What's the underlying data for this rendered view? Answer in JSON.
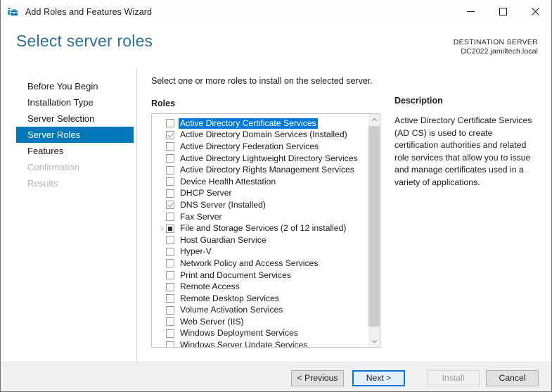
{
  "window": {
    "title": "Add Roles and Features Wizard",
    "app_icon": "wizard-toolbox-icon",
    "controls": {
      "minimize": "minimize-icon",
      "maximize": "maximize-icon",
      "close": "close-icon"
    }
  },
  "header": {
    "page_title": "Select server roles",
    "destination_label": "DESTINATION SERVER",
    "destination_value": "DC2022.jamiltech.local"
  },
  "nav": {
    "items": [
      {
        "label": "Before You Begin",
        "state": "normal"
      },
      {
        "label": "Installation Type",
        "state": "normal"
      },
      {
        "label": "Server Selection",
        "state": "normal"
      },
      {
        "label": "Server Roles",
        "state": "selected"
      },
      {
        "label": "Features",
        "state": "normal"
      },
      {
        "label": "Confirmation",
        "state": "disabled"
      },
      {
        "label": "Results",
        "state": "disabled"
      }
    ]
  },
  "main": {
    "instruction": "Select one or more roles to install on the selected server.",
    "roles_label": "Roles",
    "roles": [
      {
        "label": "Active Directory Certificate Services",
        "checked": "unchecked",
        "selected": true,
        "expandable": false
      },
      {
        "label": "Active Directory Domain Services (Installed)",
        "checked": "checked",
        "selected": false,
        "expandable": false
      },
      {
        "label": "Active Directory Federation Services",
        "checked": "unchecked",
        "selected": false,
        "expandable": false
      },
      {
        "label": "Active Directory Lightweight Directory Services",
        "checked": "unchecked",
        "selected": false,
        "expandable": false
      },
      {
        "label": "Active Directory Rights Management Services",
        "checked": "unchecked",
        "selected": false,
        "expandable": false
      },
      {
        "label": "Device Health Attestation",
        "checked": "unchecked",
        "selected": false,
        "expandable": false
      },
      {
        "label": "DHCP Server",
        "checked": "unchecked",
        "selected": false,
        "expandable": false
      },
      {
        "label": "DNS Server (Installed)",
        "checked": "checked",
        "selected": false,
        "expandable": false
      },
      {
        "label": "Fax Server",
        "checked": "unchecked",
        "selected": false,
        "expandable": false
      },
      {
        "label": "File and Storage Services (2 of 12 installed)",
        "checked": "partial",
        "selected": false,
        "expandable": true
      },
      {
        "label": "Host Guardian Service",
        "checked": "unchecked",
        "selected": false,
        "expandable": false
      },
      {
        "label": "Hyper-V",
        "checked": "unchecked",
        "selected": false,
        "expandable": false
      },
      {
        "label": "Network Policy and Access Services",
        "checked": "unchecked",
        "selected": false,
        "expandable": false
      },
      {
        "label": "Print and Document Services",
        "checked": "unchecked",
        "selected": false,
        "expandable": false
      },
      {
        "label": "Remote Access",
        "checked": "unchecked",
        "selected": false,
        "expandable": false
      },
      {
        "label": "Remote Desktop Services",
        "checked": "unchecked",
        "selected": false,
        "expandable": false
      },
      {
        "label": "Volume Activation Services",
        "checked": "unchecked",
        "selected": false,
        "expandable": false
      },
      {
        "label": "Web Server (IIS)",
        "checked": "unchecked",
        "selected": false,
        "expandable": false
      },
      {
        "label": "Windows Deployment Services",
        "checked": "unchecked",
        "selected": false,
        "expandable": false
      },
      {
        "label": "Windows Server Update Services",
        "checked": "unchecked",
        "selected": false,
        "expandable": false
      }
    ],
    "scrollbar": {
      "up_icon": "chevron-up-icon",
      "down_icon": "chevron-down-icon"
    },
    "description": {
      "title": "Description",
      "text": "Active Directory Certificate Services (AD CS) is used to create certification authorities and related role services that allow you to issue and manage certificates used in a variety of applications."
    }
  },
  "footer": {
    "previous": "< Previous",
    "next": "Next >",
    "install": "Install",
    "cancel": "Cancel"
  },
  "colors": {
    "accent_blue": "#0078d7",
    "nav_selected": "#0078ba",
    "title_teal": "#30708f",
    "footer_bg": "#f0f0f0"
  }
}
